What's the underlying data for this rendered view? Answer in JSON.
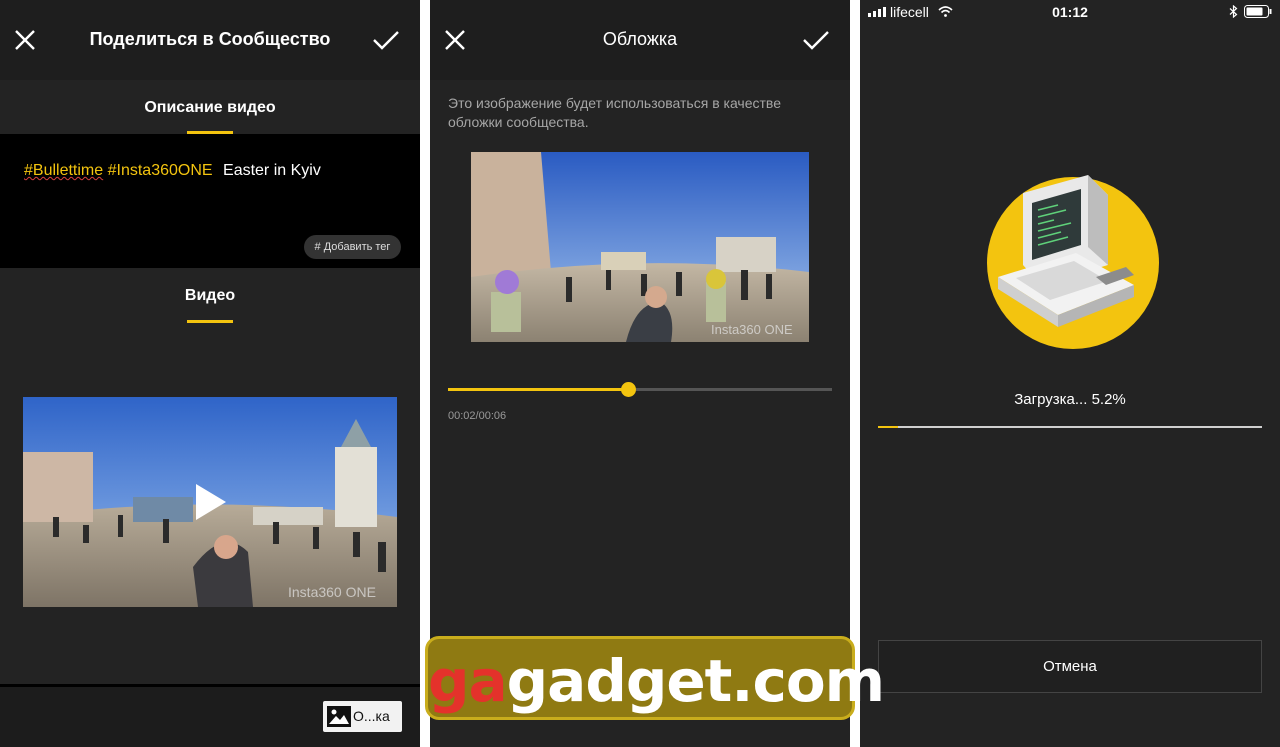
{
  "screen1": {
    "title": "Поделиться в Сообщество",
    "description_section": "Описание видео",
    "description": {
      "tag1": "#Bullettime",
      "tag2": "#Insta360ONE",
      "text": "Easter in Kyiv"
    },
    "add_tag_label": "# Добавить тег",
    "video_section": "Видео",
    "cover_button_label": "О...ка"
  },
  "screen2": {
    "title": "Обложка",
    "hint": "Это изображение будет использоваться в качестве обложки сообщества.",
    "image_watermark": "Insta360 ONE",
    "time_label": "00:02/00:06",
    "slider_fraction": 0.47
  },
  "screen3": {
    "status": {
      "carrier": "lifecell",
      "time": "01:12"
    },
    "upload_label": "Загрузка... 5.2%",
    "progress_percent": 5.2,
    "cancel_label": "Отмена"
  },
  "watermark": {
    "part1": "ga",
    "part2": "gadget.com"
  },
  "colors": {
    "accent": "#f3c40f",
    "background": "#232323",
    "header": "#1e1e1e"
  }
}
